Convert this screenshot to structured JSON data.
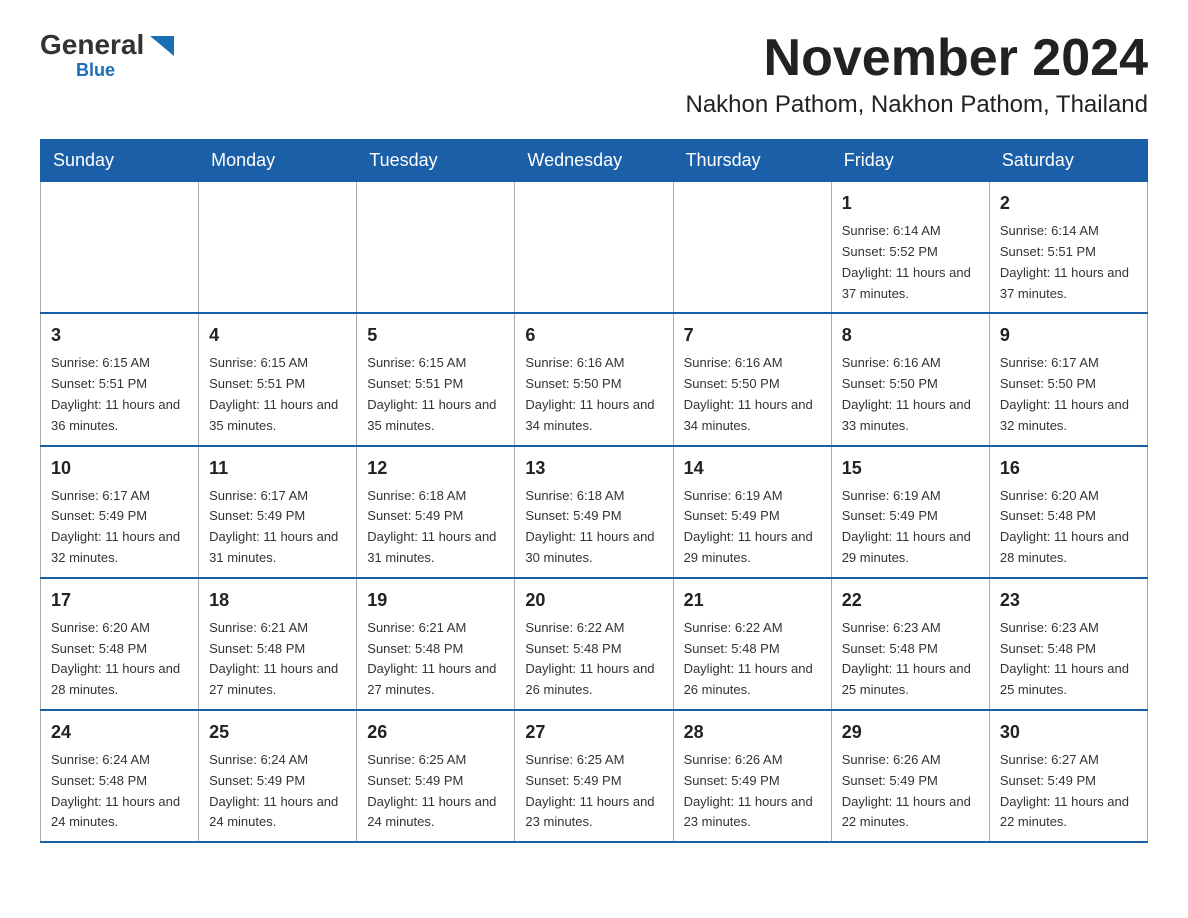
{
  "logo": {
    "general": "General",
    "blue": "Blue",
    "triangle": "▶"
  },
  "title": "November 2024",
  "subtitle": "Nakhon Pathom, Nakhon Pathom, Thailand",
  "headers": [
    "Sunday",
    "Monday",
    "Tuesday",
    "Wednesday",
    "Thursday",
    "Friday",
    "Saturday"
  ],
  "weeks": [
    [
      {
        "day": "",
        "info": ""
      },
      {
        "day": "",
        "info": ""
      },
      {
        "day": "",
        "info": ""
      },
      {
        "day": "",
        "info": ""
      },
      {
        "day": "",
        "info": ""
      },
      {
        "day": "1",
        "info": "Sunrise: 6:14 AM\nSunset: 5:52 PM\nDaylight: 11 hours and 37 minutes."
      },
      {
        "day": "2",
        "info": "Sunrise: 6:14 AM\nSunset: 5:51 PM\nDaylight: 11 hours and 37 minutes."
      }
    ],
    [
      {
        "day": "3",
        "info": "Sunrise: 6:15 AM\nSunset: 5:51 PM\nDaylight: 11 hours and 36 minutes."
      },
      {
        "day": "4",
        "info": "Sunrise: 6:15 AM\nSunset: 5:51 PM\nDaylight: 11 hours and 35 minutes."
      },
      {
        "day": "5",
        "info": "Sunrise: 6:15 AM\nSunset: 5:51 PM\nDaylight: 11 hours and 35 minutes."
      },
      {
        "day": "6",
        "info": "Sunrise: 6:16 AM\nSunset: 5:50 PM\nDaylight: 11 hours and 34 minutes."
      },
      {
        "day": "7",
        "info": "Sunrise: 6:16 AM\nSunset: 5:50 PM\nDaylight: 11 hours and 34 minutes."
      },
      {
        "day": "8",
        "info": "Sunrise: 6:16 AM\nSunset: 5:50 PM\nDaylight: 11 hours and 33 minutes."
      },
      {
        "day": "9",
        "info": "Sunrise: 6:17 AM\nSunset: 5:50 PM\nDaylight: 11 hours and 32 minutes."
      }
    ],
    [
      {
        "day": "10",
        "info": "Sunrise: 6:17 AM\nSunset: 5:49 PM\nDaylight: 11 hours and 32 minutes."
      },
      {
        "day": "11",
        "info": "Sunrise: 6:17 AM\nSunset: 5:49 PM\nDaylight: 11 hours and 31 minutes."
      },
      {
        "day": "12",
        "info": "Sunrise: 6:18 AM\nSunset: 5:49 PM\nDaylight: 11 hours and 31 minutes."
      },
      {
        "day": "13",
        "info": "Sunrise: 6:18 AM\nSunset: 5:49 PM\nDaylight: 11 hours and 30 minutes."
      },
      {
        "day": "14",
        "info": "Sunrise: 6:19 AM\nSunset: 5:49 PM\nDaylight: 11 hours and 29 minutes."
      },
      {
        "day": "15",
        "info": "Sunrise: 6:19 AM\nSunset: 5:49 PM\nDaylight: 11 hours and 29 minutes."
      },
      {
        "day": "16",
        "info": "Sunrise: 6:20 AM\nSunset: 5:48 PM\nDaylight: 11 hours and 28 minutes."
      }
    ],
    [
      {
        "day": "17",
        "info": "Sunrise: 6:20 AM\nSunset: 5:48 PM\nDaylight: 11 hours and 28 minutes."
      },
      {
        "day": "18",
        "info": "Sunrise: 6:21 AM\nSunset: 5:48 PM\nDaylight: 11 hours and 27 minutes."
      },
      {
        "day": "19",
        "info": "Sunrise: 6:21 AM\nSunset: 5:48 PM\nDaylight: 11 hours and 27 minutes."
      },
      {
        "day": "20",
        "info": "Sunrise: 6:22 AM\nSunset: 5:48 PM\nDaylight: 11 hours and 26 minutes."
      },
      {
        "day": "21",
        "info": "Sunrise: 6:22 AM\nSunset: 5:48 PM\nDaylight: 11 hours and 26 minutes."
      },
      {
        "day": "22",
        "info": "Sunrise: 6:23 AM\nSunset: 5:48 PM\nDaylight: 11 hours and 25 minutes."
      },
      {
        "day": "23",
        "info": "Sunrise: 6:23 AM\nSunset: 5:48 PM\nDaylight: 11 hours and 25 minutes."
      }
    ],
    [
      {
        "day": "24",
        "info": "Sunrise: 6:24 AM\nSunset: 5:48 PM\nDaylight: 11 hours and 24 minutes."
      },
      {
        "day": "25",
        "info": "Sunrise: 6:24 AM\nSunset: 5:49 PM\nDaylight: 11 hours and 24 minutes."
      },
      {
        "day": "26",
        "info": "Sunrise: 6:25 AM\nSunset: 5:49 PM\nDaylight: 11 hours and 24 minutes."
      },
      {
        "day": "27",
        "info": "Sunrise: 6:25 AM\nSunset: 5:49 PM\nDaylight: 11 hours and 23 minutes."
      },
      {
        "day": "28",
        "info": "Sunrise: 6:26 AM\nSunset: 5:49 PM\nDaylight: 11 hours and 23 minutes."
      },
      {
        "day": "29",
        "info": "Sunrise: 6:26 AM\nSunset: 5:49 PM\nDaylight: 11 hours and 22 minutes."
      },
      {
        "day": "30",
        "info": "Sunrise: 6:27 AM\nSunset: 5:49 PM\nDaylight: 11 hours and 22 minutes."
      }
    ]
  ]
}
